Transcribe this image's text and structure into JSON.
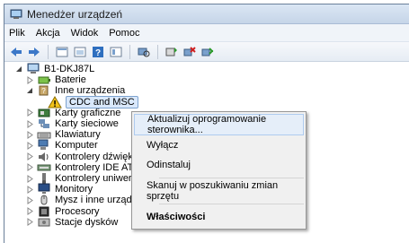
{
  "window": {
    "title": "Menedżer urządzeń"
  },
  "menu": [
    "Plik",
    "Akcja",
    "Widok",
    "Pomoc"
  ],
  "toolbar_icons": [
    "back-icon",
    "forward-icon",
    "properties-grid-icon",
    "view-icon",
    "help-icon",
    "list-icon",
    "scan-icon",
    "update-driver-icon",
    "uninstall-icon",
    "enable-icon"
  ],
  "tree": [
    {
      "label": "B1-DKJ87L",
      "icon": "computer-icon",
      "expander": "open",
      "indent": 0
    },
    {
      "label": "Baterie",
      "icon": "battery-icon",
      "expander": "closed",
      "indent": 1
    },
    {
      "label": "Inne urządzenia",
      "icon": "unknown-device-icon",
      "expander": "open",
      "indent": 1
    },
    {
      "label": "CDC and MSC",
      "icon": "warning-device-icon",
      "expander": "none",
      "indent": 2,
      "selected": true
    },
    {
      "label": "Karty graficzne",
      "icon": "display-adapter-icon",
      "expander": "closed",
      "indent": 1
    },
    {
      "label": "Karty sieciowe",
      "icon": "network-icon",
      "expander": "closed",
      "indent": 1
    },
    {
      "label": "Klawiatury",
      "icon": "keyboard-icon",
      "expander": "closed",
      "indent": 1
    },
    {
      "label": "Komputer",
      "icon": "pc-icon",
      "expander": "closed",
      "indent": 1
    },
    {
      "label": "Kontrolery dźwięk",
      "icon": "sound-icon",
      "expander": "closed",
      "indent": 1
    },
    {
      "label": "Kontrolery IDE AT",
      "icon": "ide-icon",
      "expander": "closed",
      "indent": 1
    },
    {
      "label": "Kontrolery uniwer",
      "icon": "usb-icon",
      "expander": "closed",
      "indent": 1
    },
    {
      "label": "Monitory",
      "icon": "monitor-icon",
      "expander": "closed",
      "indent": 1
    },
    {
      "label": "Mysz i inne urządzenia wskazujące",
      "icon": "mouse-icon",
      "expander": "closed",
      "indent": 1
    },
    {
      "label": "Procesory",
      "icon": "cpu-icon",
      "expander": "closed",
      "indent": 1
    },
    {
      "label": "Stacje dysków",
      "icon": "disk-icon",
      "expander": "closed",
      "indent": 1
    }
  ],
  "context_menu": {
    "update_driver": "Aktualizuj oprogramowanie sterownika...",
    "disable": "Wyłącz",
    "uninstall": "Odinstaluj",
    "scan": "Skanuj w poszukiwaniu zmian sprzętu",
    "properties": "Właściwości"
  }
}
